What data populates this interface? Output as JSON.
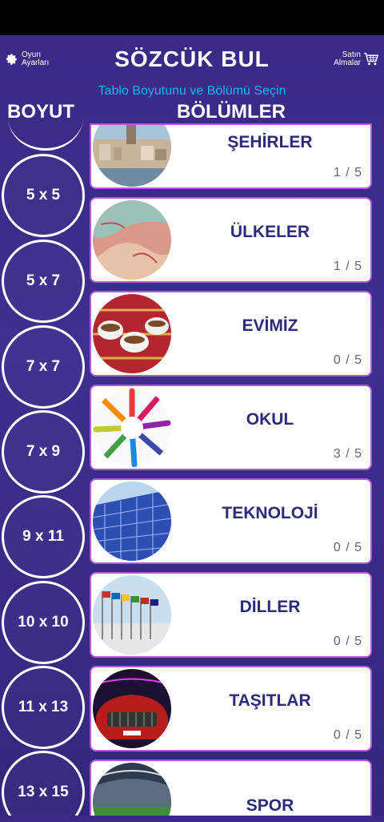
{
  "header": {
    "settings_label_line1": "Oyun",
    "settings_label_line2": "Ayarları",
    "title": "SÖZCÜK BUL",
    "store_label_line1": "Satın",
    "store_label_line2": "Almalar",
    "subtitle": "Tablo Boyutunu ve Bölümü Seçin",
    "col_size": "BOYUT",
    "col_sections": "BÖLÜMLER"
  },
  "sizes": [
    "5 x 5",
    "5 x 7",
    "7 x 7",
    "7 x 9",
    "9 x 11",
    "10 x 10",
    "11 x 13",
    "13 x 15"
  ],
  "sections": [
    {
      "name": "ŞEHİRLER",
      "progress": "1 / 5",
      "icon": "city-photo"
    },
    {
      "name": "ÜLKELER",
      "progress": "1 / 5",
      "icon": "globe-photo"
    },
    {
      "name": "EVİMİZ",
      "progress": "0 / 5",
      "icon": "tea-cups-photo"
    },
    {
      "name": "OKUL",
      "progress": "3 / 5",
      "icon": "colored-pencils-photo"
    },
    {
      "name": "TEKNOLOJİ",
      "progress": "0 / 5",
      "icon": "solar-panel-photo"
    },
    {
      "name": "DİLLER",
      "progress": "0 / 5",
      "icon": "flags-photo"
    },
    {
      "name": "TAŞITLAR",
      "progress": "0 / 5",
      "icon": "car-photo"
    },
    {
      "name": "SPOR",
      "progress": "",
      "icon": "stadium-photo"
    }
  ],
  "colors": {
    "background": "#3a2a86",
    "accent": "#18b3ea",
    "card_text": "#2d2a7c",
    "card_border": "#b25ad6"
  }
}
